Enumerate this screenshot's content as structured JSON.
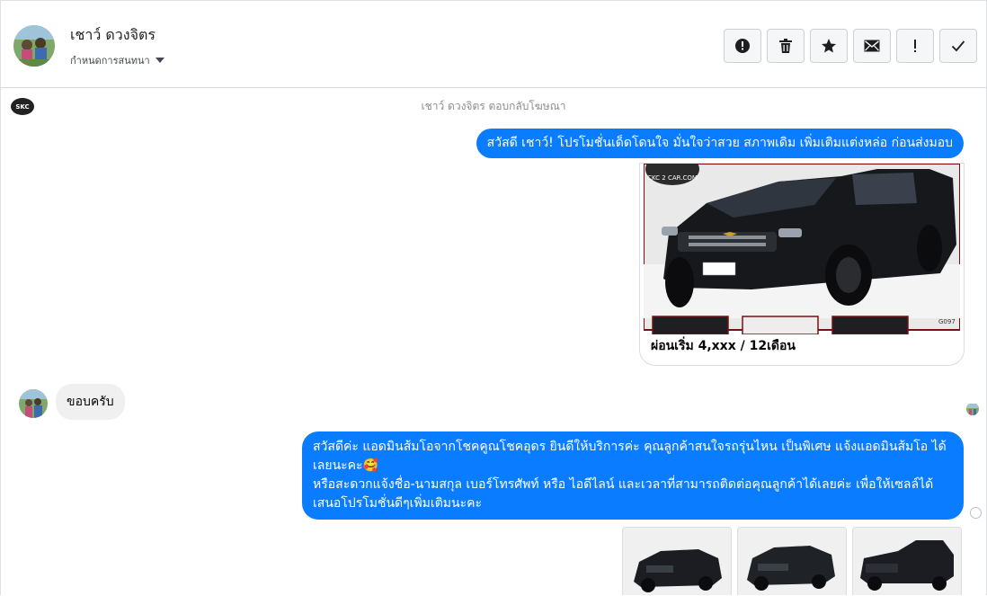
{
  "header": {
    "contact_name": "เชาว์ ดวงจิตร",
    "manage_label": "กำหนดการสนทนา",
    "tools": [
      "alert-icon",
      "trash-icon",
      "star-icon",
      "envelope-icon",
      "exclamation-icon",
      "check-icon"
    ]
  },
  "thread": {
    "page_logo_text": "SKC",
    "ad_reply_notice": "เชาว์ ดวงจิตร ตอบกลับโฆษณา",
    "outgoing_1": "สวัสดี เชาว์! โปรโมชั่นเด็ดโดนใจ มั่นใจว่าสวย สภาพเดิม เพิ่มเติมแต่งหล่อ ก่อนส่งมอบ",
    "card": {
      "caption": "ผ่อนเริ่ม 4,xxx / 12เดือน",
      "watermark": "CKC 2 CAR.COM",
      "stock_code": "G097"
    },
    "incoming_1": "ขอบครับ",
    "outgoing_2_lines": [
      "สวัสดีค่ะ แอดมินส้มโอจากโชคคูณโชคอุดร ยินดีให้บริการค่ะ   คุณลูกค้าสนใจรถรุ่นไหน เป็นพิเศษ แจ้งแอดมินส้มโอ ได้เลยนะคะ🥰",
      "หรือสะดวกแจ้งชื่อ-นามสกุล เบอร์โทรศัพท์ หรือ ไอดีไลน์ และเวลาที่สามารถติดต่อคุณลูกค้าได้เลยค่ะ เพื่อให้เซลล์ได้เสนอโปรโมชั่นดีๆเพิ่มเติมนะคะ"
    ]
  },
  "colors": {
    "outgoing_bubble": "#0a7cff",
    "incoming_bubble": "#f0f0f0",
    "notice_text": "#8a8d91"
  }
}
